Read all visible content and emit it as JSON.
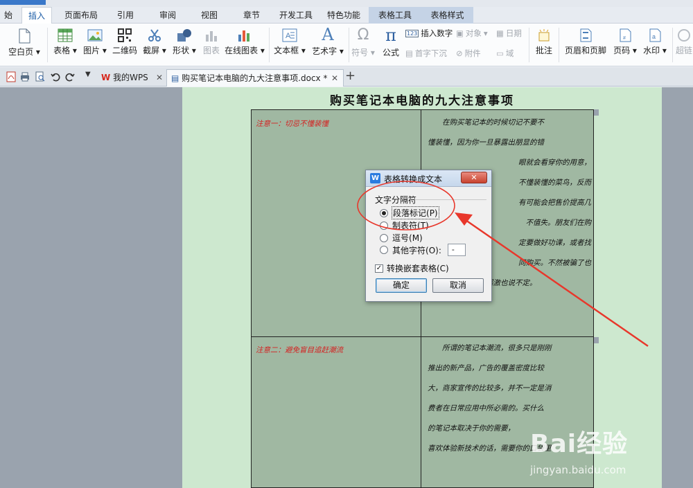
{
  "ribbon_tabs": [
    {
      "label": "始",
      "active": false
    },
    {
      "label": "插入",
      "active": true
    },
    {
      "label": "页面布局",
      "active": false
    },
    {
      "label": "引用",
      "active": false
    },
    {
      "label": "审阅",
      "active": false
    },
    {
      "label": "视图",
      "active": false
    },
    {
      "label": "章节",
      "active": false
    },
    {
      "label": "开发工具",
      "active": false
    },
    {
      "label": "特色功能",
      "active": false
    },
    {
      "label": "表格工具",
      "active": false
    },
    {
      "label": "表格样式",
      "active": false
    }
  ],
  "ribbon": {
    "blank_page": "空白页",
    "table": "表格",
    "picture": "图片",
    "qrcode": "二维码",
    "screenshot": "截屏",
    "shape": "形状",
    "chart": "图表",
    "online_chart": "在线图表",
    "textbox": "文本框",
    "wordart": "艺术字",
    "symbol": "符号",
    "formula": "公式",
    "insert_number": "插入数字",
    "object": "对象",
    "date": "日期",
    "dropcap": "首字下沉",
    "attachment": "附件",
    "field": "域",
    "comment": "批注",
    "header_footer": "页眉和页脚",
    "page_number": "页码",
    "watermark": "水印",
    "superlink": "超链"
  },
  "doc_tabs": {
    "home_tab": "我的WPS",
    "doc_tab": "购买笔记本电脑的九大注意事项.docx *",
    "add_tab": "+"
  },
  "document": {
    "title": "购买笔记本电脑的九大注意事项",
    "rows": [
      {
        "heading": "注意一：切忌不懂装懂",
        "lines": [
          "在购买笔记本的时候切记不要不",
          "懂装懂，因为你一旦暴露出朋显的错",
          "眼就会看穿你的用意，",
          "不懂装懂的菜鸟，反而",
          "有可能会把售价提高几",
          "不值失。朋友们在购",
          "定要做好功课，或者找",
          "同购买。不然被骗了也",
          "许还对经销商心存感激也说不定。"
        ]
      },
      {
        "heading": "注意二：避免盲目追赶潮流",
        "lines": [
          "所谓的笔记本潮流，很多只是刚刚",
          "推出的新产品，广告的覆盖密度比较",
          "大，商家宣传的比较多，并不一定是消",
          "费者在日常应用中所必需的。买什么",
          "的笔记本取决于你的需要，",
          "喜欢体验新技术的话，需要你的口袋里"
        ]
      }
    ]
  },
  "dialog": {
    "title": "表格转换成文本",
    "close": "✕",
    "group_label": "文字分隔符",
    "options": [
      {
        "label": "段落标记",
        "key": "(P)",
        "selected": true
      },
      {
        "label": "制表符",
        "key": "(T)",
        "selected": false
      },
      {
        "label": "逗号",
        "key": "(M)",
        "selected": false
      },
      {
        "label": "其他字符",
        "key": "(O):",
        "selected": false
      }
    ],
    "other_char_value": "-",
    "nested_checkbox": {
      "label": "转换嵌套表格(C)",
      "checked": true
    },
    "ok": "确定",
    "cancel": "取消"
  },
  "watermark": {
    "text": "Bai经验",
    "url": "jingyan.baidu.com"
  },
  "colors": {
    "accent": "#1f5fa8",
    "annotation_red": "#e8372b",
    "page_green": "#cde8cf",
    "table_cell": "#a0b8a2",
    "heading_red": "#d42020"
  }
}
